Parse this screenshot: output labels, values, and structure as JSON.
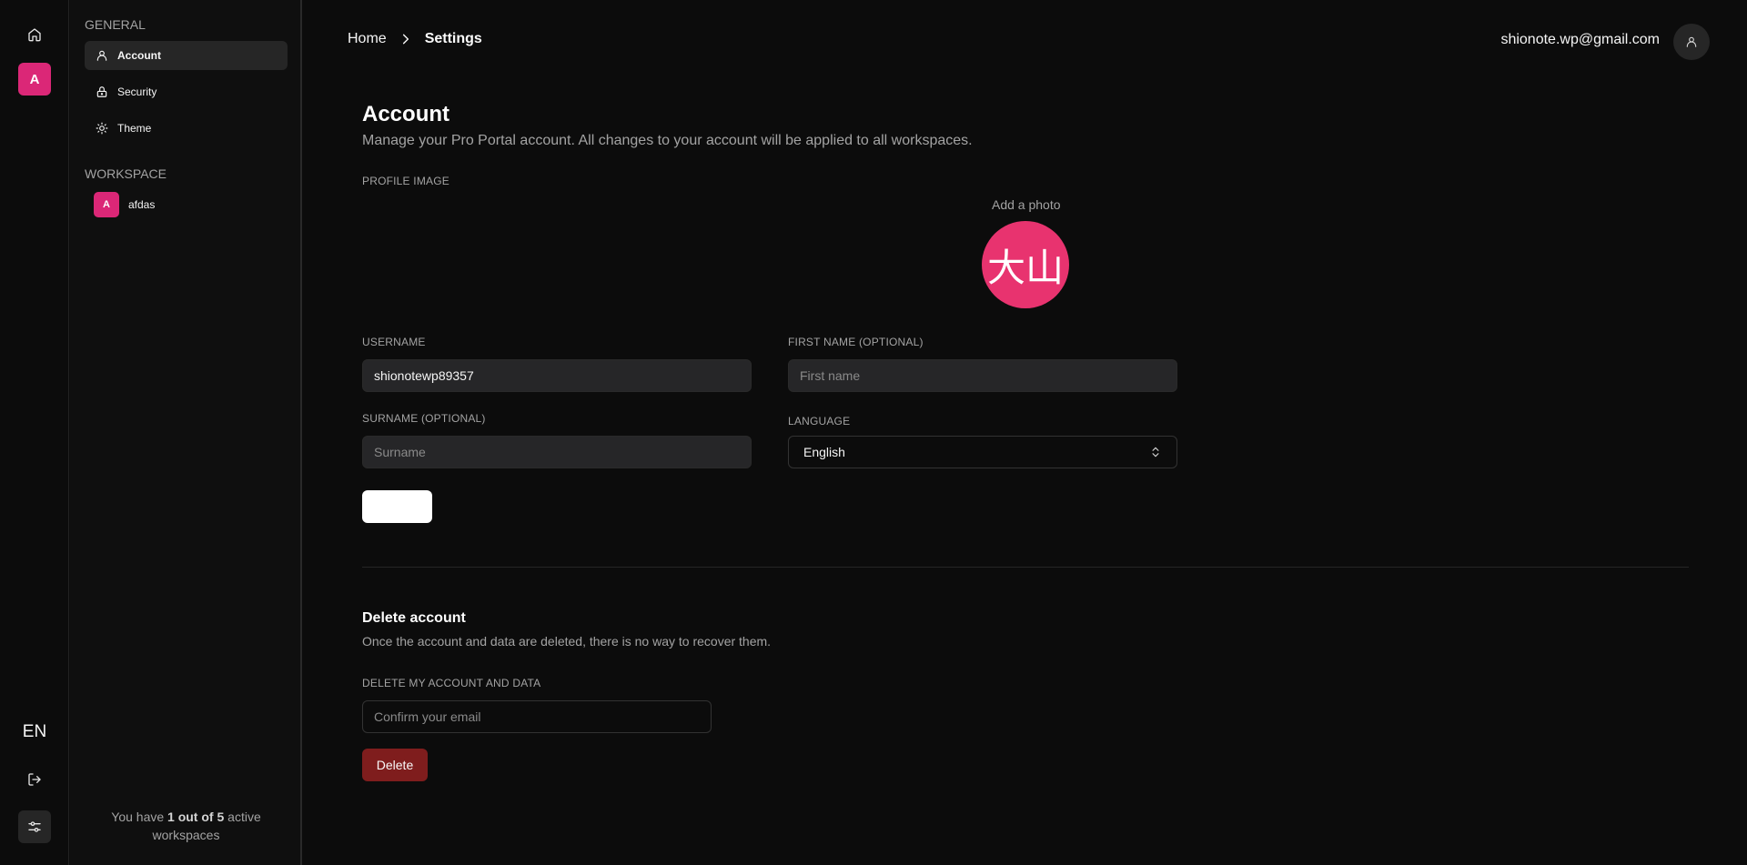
{
  "rail": {
    "workspace_initial": "A",
    "language": "EN"
  },
  "sidebar": {
    "general_heading": "GENERAL",
    "items": [
      {
        "label": "Account",
        "icon": "user-icon",
        "active": true
      },
      {
        "label": "Security",
        "icon": "lock-icon",
        "active": false
      },
      {
        "label": "Theme",
        "icon": "sun-icon",
        "active": false
      }
    ],
    "workspace_heading": "WORKSPACE",
    "workspaces": [
      {
        "initial": "A",
        "name": "afdas"
      }
    ],
    "footer": {
      "prefix": "You have",
      "count": "1 out of 5",
      "suffix": "active workspaces"
    }
  },
  "header": {
    "breadcrumb": {
      "home": "Home",
      "current": "Settings"
    },
    "email": "shionote.wp@gmail.com"
  },
  "account": {
    "title": "Account",
    "description": "Manage your Pro Portal account. All changes to your account will be applied to all workspaces.",
    "profile_image_label": "PROFILE IMAGE",
    "add_photo": "Add a photo",
    "avatar_text": "大山",
    "username_label": "USERNAME",
    "username_value": "shionotewp89357",
    "first_name_label": "FIRST NAME (OPTIONAL)",
    "first_name_placeholder": "First name",
    "surname_label": "SURNAME (OPTIONAL)",
    "surname_placeholder": "Surname",
    "language_label": "LANGUAGE",
    "language_value": "English"
  },
  "delete_account": {
    "title": "Delete account",
    "description": "Once the account and data are deleted, there is no way to recover them.",
    "field_label": "DELETE MY ACCOUNT AND DATA",
    "email_placeholder": "Confirm your email",
    "button_label": "Delete"
  },
  "colors": {
    "accent": "#db2777",
    "avatar": "#e8336f",
    "danger": "#7f1d1d",
    "background": "#0c0c0c"
  }
}
